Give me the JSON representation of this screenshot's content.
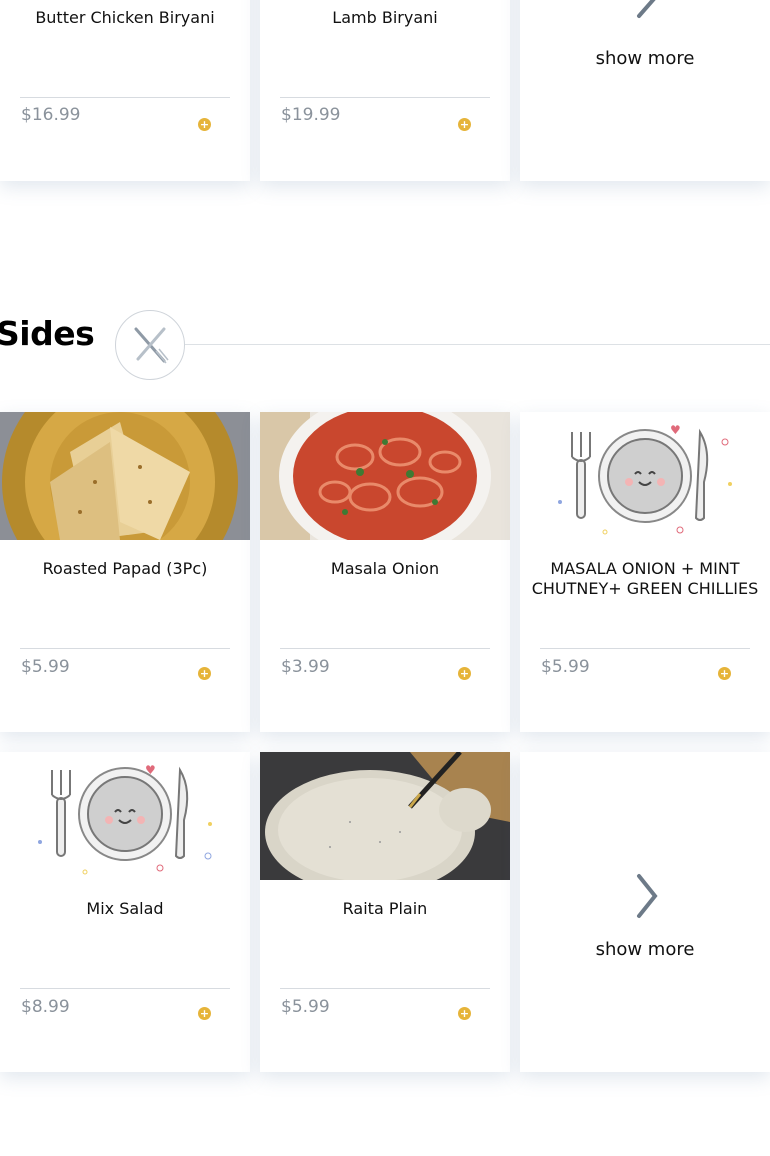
{
  "top_row": {
    "cards": [
      {
        "name": "Butter Chicken Biryani",
        "price": "$16.99"
      },
      {
        "name": "Lamb Biryani",
        "price": "$19.99"
      }
    ],
    "show_more": "show more"
  },
  "sides": {
    "title": "Sides",
    "row1": [
      {
        "name": "Roasted Papad (3Pc)",
        "price": "$5.99"
      },
      {
        "name": "Masala Onion",
        "price": "$3.99"
      },
      {
        "name": "MASALA ONION + MINT CHUTNEY+ GREEN CHILLIES",
        "price": "$5.99"
      }
    ],
    "row2": [
      {
        "name": "Mix Salad",
        "price": "$8.99"
      },
      {
        "name": "Raita Plain",
        "price": "$5.99"
      }
    ],
    "show_more": "show more"
  },
  "icons": {
    "add": "plus-circle-icon",
    "chevron": "chevron-right-icon",
    "section": "fork-knife-icon"
  },
  "colors": {
    "accent": "#e6b43a",
    "price": "#8a929b",
    "chevron": "#6d7a88"
  }
}
